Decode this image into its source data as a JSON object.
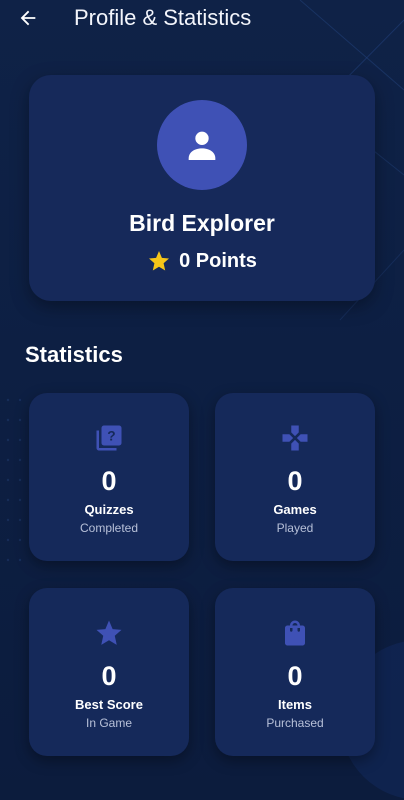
{
  "header": {
    "title": "Profile & Statistics",
    "back_icon": "arrow-left-icon"
  },
  "profile": {
    "avatar_icon": "person-icon",
    "name": "Bird Explorer",
    "points_icon": "star-icon",
    "points_text": "0 Points"
  },
  "statistics": {
    "heading": "Statistics",
    "cards": [
      {
        "icon": "quiz-icon",
        "value": "0",
        "label": "Quizzes",
        "sub": "Completed"
      },
      {
        "icon": "gamepad-icon",
        "value": "0",
        "label": "Games",
        "sub": "Played"
      },
      {
        "icon": "star-icon",
        "value": "0",
        "label": "Best Score",
        "sub": "In Game"
      },
      {
        "icon": "shopping-bag-icon",
        "value": "0",
        "label": "Items",
        "sub": "Purchased"
      }
    ]
  },
  "colors": {
    "background": "#0f2247",
    "card": "#16295a",
    "accent": "#3f51b5",
    "star": "#f5c518",
    "stat_icon": "#3f51b5"
  }
}
